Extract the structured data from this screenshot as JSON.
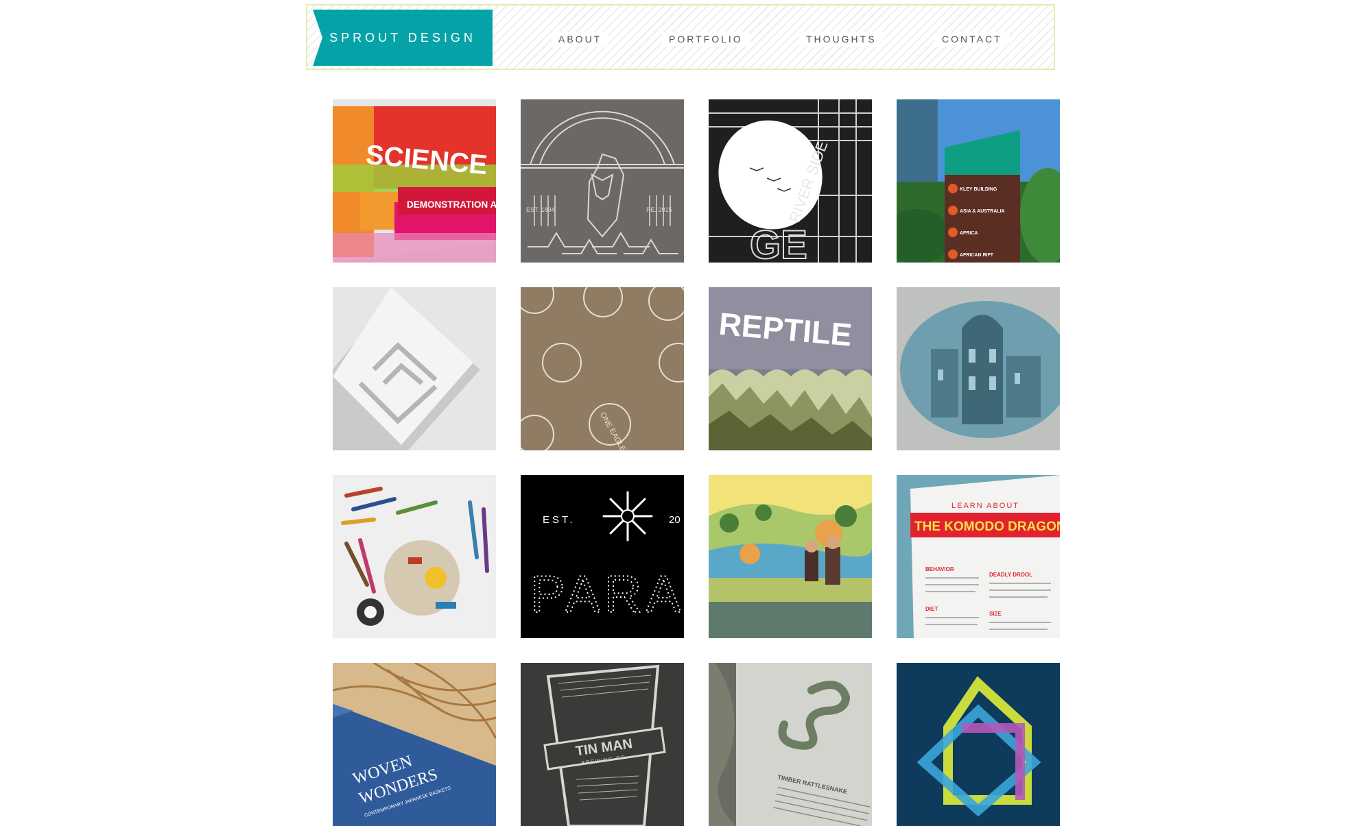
{
  "header": {
    "logo": "SPROUT DESIGN",
    "nav": [
      {
        "label": "ABOUT"
      },
      {
        "label": "PORTFOLIO"
      },
      {
        "label": "THOUGHTS"
      },
      {
        "label": "CONTACT"
      }
    ]
  },
  "tiles": {
    "science": {
      "line1": "SCIENCE",
      "line2": "DEMONSTRATION AREA"
    },
    "eagle": {
      "est": "EST. 1894",
      "re": "RE. 2015"
    },
    "typography": {
      "text": "RIVER SIDE",
      "letters": "GE"
    },
    "wayfinding": {
      "line1": "KLEY BUILDING",
      "line2": "ASIA & AUSTRALIA",
      "line3": "AFRICA",
      "line4": "AFRICAN RIFT"
    },
    "sign3d": {},
    "stamps": {
      "text": "ONE EAGLE"
    },
    "reptile": {
      "text": "REPTILE"
    },
    "building": {},
    "tools": {},
    "para": {
      "est": "EST.",
      "year": "20",
      "word": "PARA"
    },
    "mural": {},
    "komodo": {
      "kicker": "LEARN ABOUT",
      "title": "THE KOMODO DRAGON",
      "h1": "BEHAVIOR",
      "h2": "DEADLY DROOL",
      "h3": "DIET",
      "h4": "SIZE"
    },
    "woven": {
      "line1": "WOVEN",
      "line2": "WONDERS",
      "sub": "CONTEMPORARY JAPANESE BASKETS"
    },
    "tinman": {
      "line1": "TIN MAN",
      "line2": "BREWING CO."
    },
    "snake": {
      "caption": "TIMBER RATTLESNAKE"
    },
    "geo": {}
  }
}
